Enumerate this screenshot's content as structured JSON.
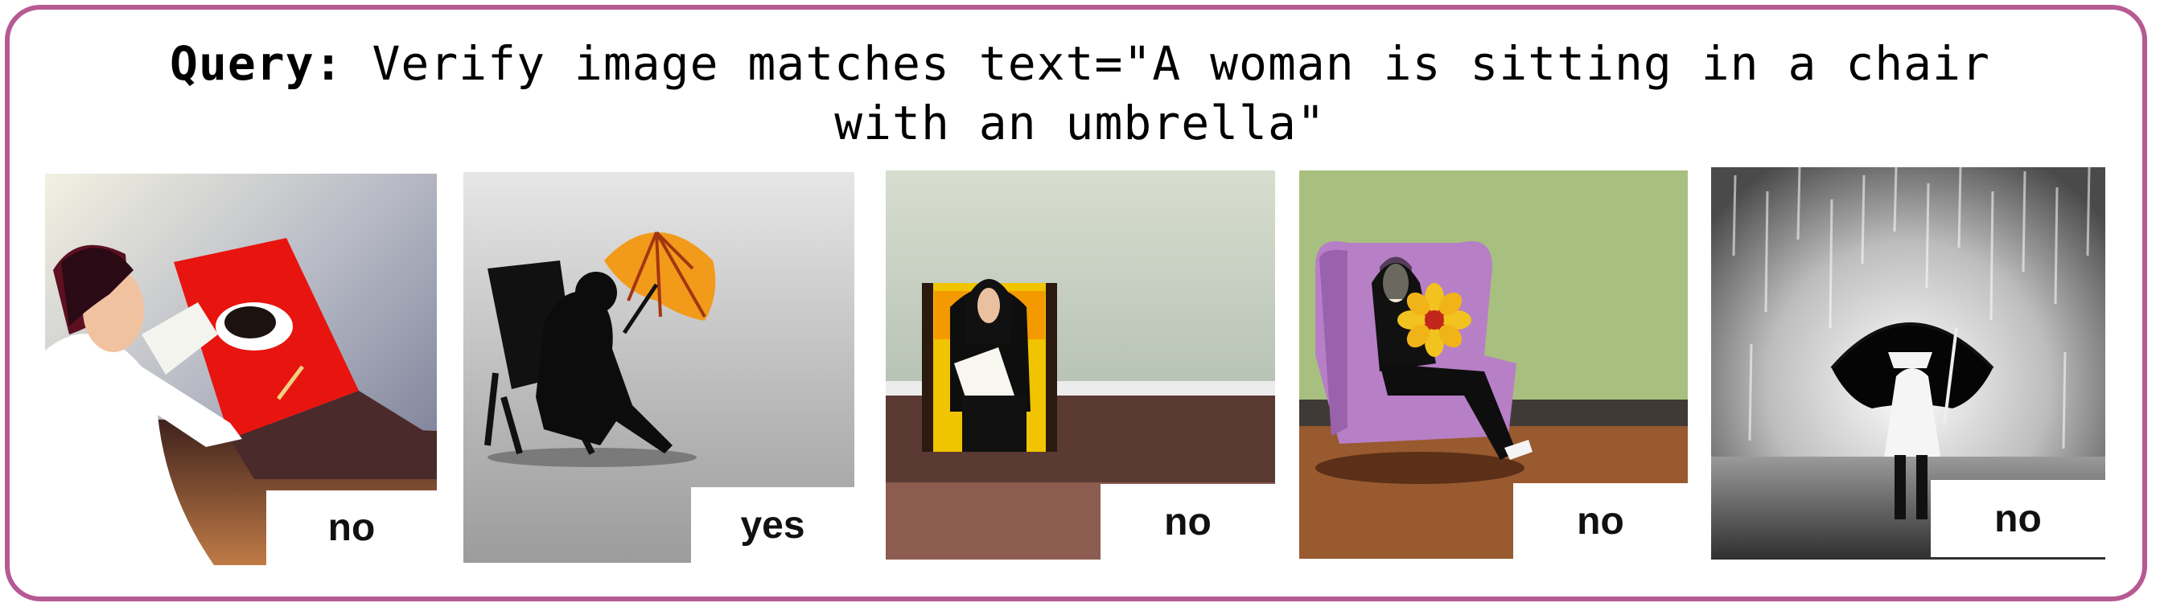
{
  "query": {
    "prefix": "Query:",
    "line1": " Verify image matches text=\"A woman is sitting in a chair",
    "line2": "with an umbrella\""
  },
  "panels": [
    {
      "answer": "no"
    },
    {
      "answer": "yes"
    },
    {
      "answer": "no"
    },
    {
      "answer": "no"
    },
    {
      "answer": "no"
    }
  ],
  "colors": {
    "frame": "#b65a93"
  }
}
